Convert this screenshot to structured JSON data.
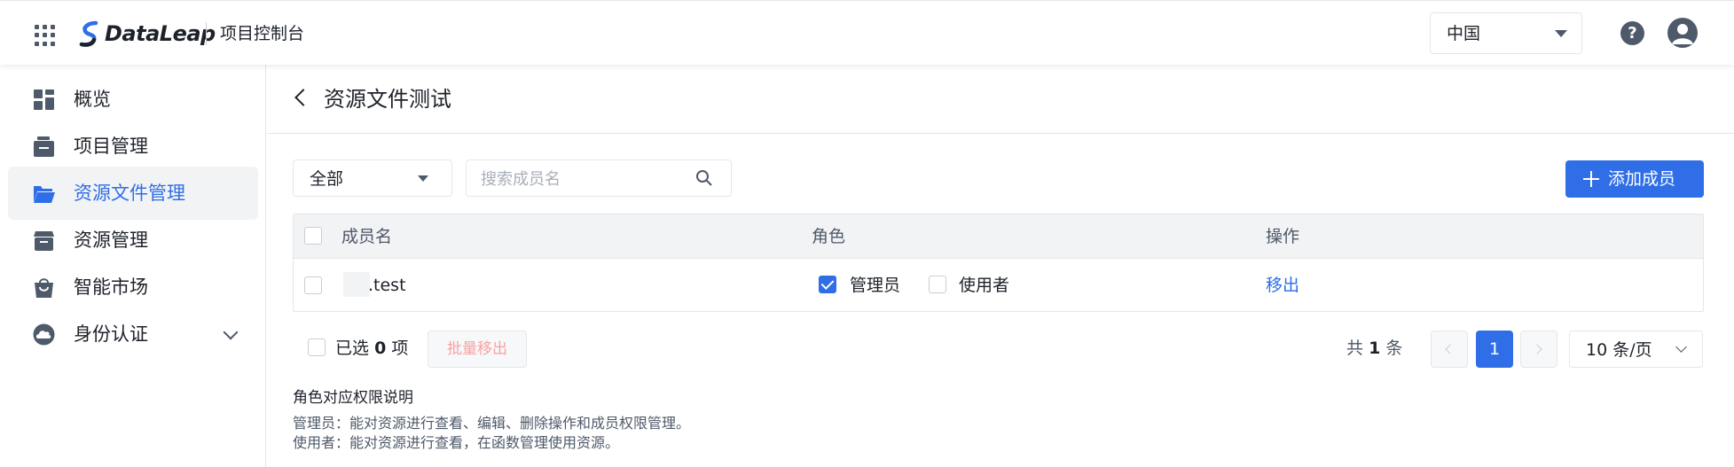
{
  "header": {
    "logo_text": "DataLeap",
    "console_title": "项目控制台",
    "region": "中国"
  },
  "sidebar": {
    "items": [
      {
        "label": "概览",
        "icon": "dashboard-icon"
      },
      {
        "label": "项目管理",
        "icon": "folder-stack-icon"
      },
      {
        "label": "资源文件管理",
        "icon": "folder-open-icon",
        "active": true
      },
      {
        "label": "资源管理",
        "icon": "box-icon"
      },
      {
        "label": "智能市场",
        "icon": "shopping-bag-icon"
      },
      {
        "label": "身份认证",
        "icon": "cloud-icon",
        "expandable": true
      }
    ]
  },
  "page": {
    "title": "资源文件测试"
  },
  "toolbar": {
    "filter_value": "全部",
    "search_placeholder": "搜索成员名",
    "add_label": "添加成员"
  },
  "table": {
    "columns": [
      "成员名",
      "角色",
      "操作"
    ],
    "rows": [
      {
        "member": ".test",
        "role_admin": "管理员",
        "role_user": "使用者",
        "admin_checked": true,
        "user_checked": false,
        "action": "移出"
      }
    ]
  },
  "footer": {
    "selected_prefix": "已选",
    "selected_count": "0",
    "selected_suffix": "项",
    "batch_remove": "批量移出",
    "total_prefix": "共",
    "total_count": "1",
    "total_suffix": "条",
    "current_page": "1",
    "page_size": "10 条/页"
  },
  "permissions": {
    "title": "角色对应权限说明",
    "admin_desc": "管理员：能对资源进行查看、编辑、删除操作和成员权限管理。",
    "user_desc": "使用者：能对资源进行查看，在函数管理使用资源。"
  },
  "colors": {
    "primary": "#2f6ee6",
    "icon_gray": "#4e5969",
    "border": "#e5e6eb"
  }
}
